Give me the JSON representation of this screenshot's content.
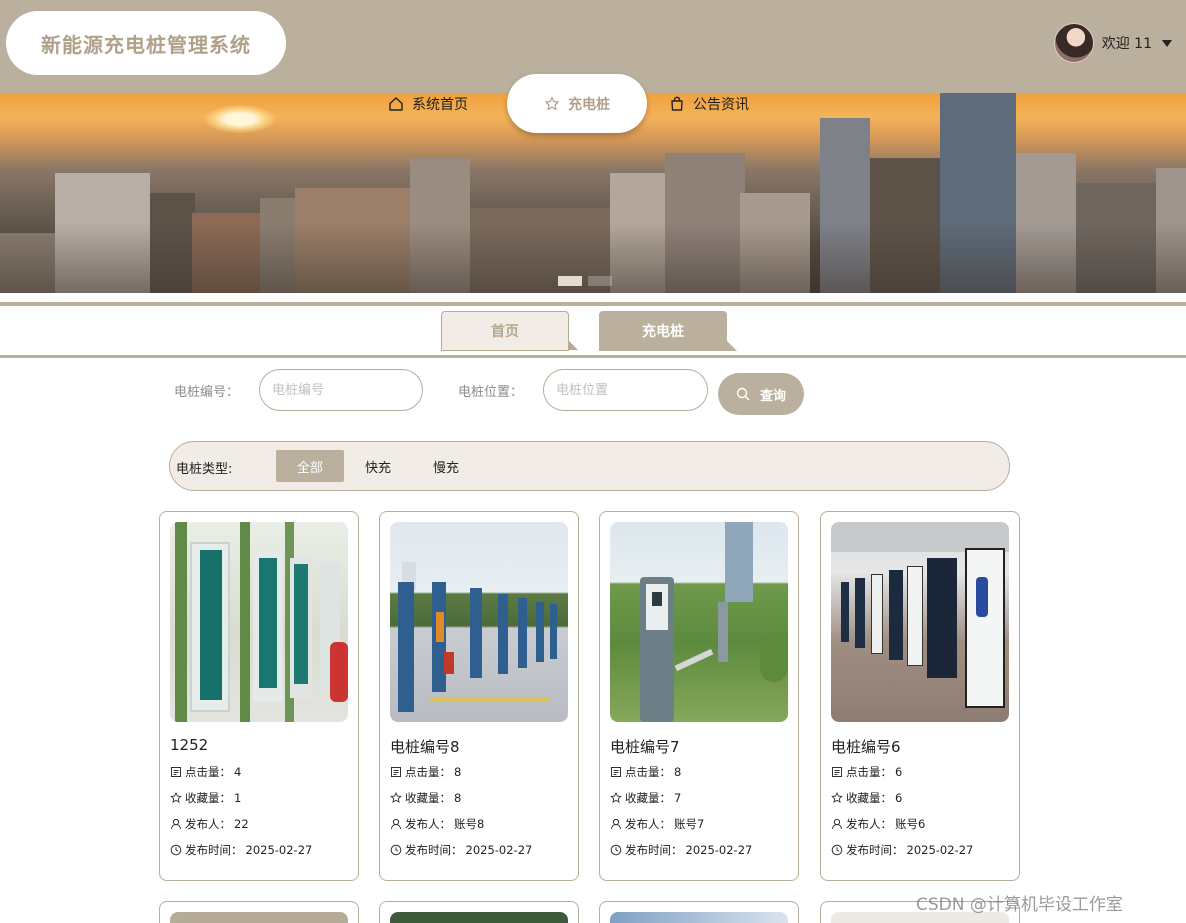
{
  "header": {
    "logo_text": "新能源充电桩管理系统",
    "welcome": "欢迎 11"
  },
  "nav": {
    "items": [
      {
        "label": "系统首页",
        "icon": "home-icon"
      },
      {
        "label": "充电桩",
        "icon": "star-icon",
        "active": true
      },
      {
        "label": "公告资讯",
        "icon": "bag-icon"
      }
    ]
  },
  "tabs": [
    {
      "label": "首页"
    },
    {
      "label": "充电桩",
      "active": true
    }
  ],
  "search": {
    "code_label": "电桩编号：",
    "code_placeholder": "电桩编号",
    "code_value": "",
    "location_label": "电桩位置：",
    "location_placeholder": "电桩位置",
    "location_value": "",
    "button_label": "查询"
  },
  "type_filter": {
    "label": "电桩类型:",
    "options": [
      "全部",
      "快充",
      "慢充"
    ],
    "selected": "全部"
  },
  "cards": [
    {
      "title": "1252",
      "clicks_label": "点击量：",
      "clicks": "4",
      "favs_label": "收藏量：",
      "favs": "1",
      "publisher_label": "发布人：",
      "publisher": "22",
      "time_label": "发布时间：",
      "time": "2025-02-27"
    },
    {
      "title": "电桩编号8",
      "clicks_label": "点击量：",
      "clicks": "8",
      "favs_label": "收藏量：",
      "favs": "8",
      "publisher_label": "发布人：",
      "publisher": "账号8",
      "time_label": "发布时间：",
      "time": "2025-02-27"
    },
    {
      "title": "电桩编号7",
      "clicks_label": "点击量：",
      "clicks": "8",
      "favs_label": "收藏量：",
      "favs": "7",
      "publisher_label": "发布人：",
      "publisher": "账号7",
      "time_label": "发布时间：",
      "time": "2025-02-27"
    },
    {
      "title": "电桩编号6",
      "clicks_label": "点击量：",
      "clicks": "6",
      "favs_label": "收藏量：",
      "favs": "6",
      "publisher_label": "发布人：",
      "publisher": "账号6",
      "time_label": "发布时间：",
      "time": "2025-02-27"
    }
  ],
  "colors": {
    "brand": "#bbaf9d",
    "brand_light": "#f1ede6",
    "logo_text": "#b0a18b"
  },
  "watermark": "CSDN @计算机毕设工作室"
}
